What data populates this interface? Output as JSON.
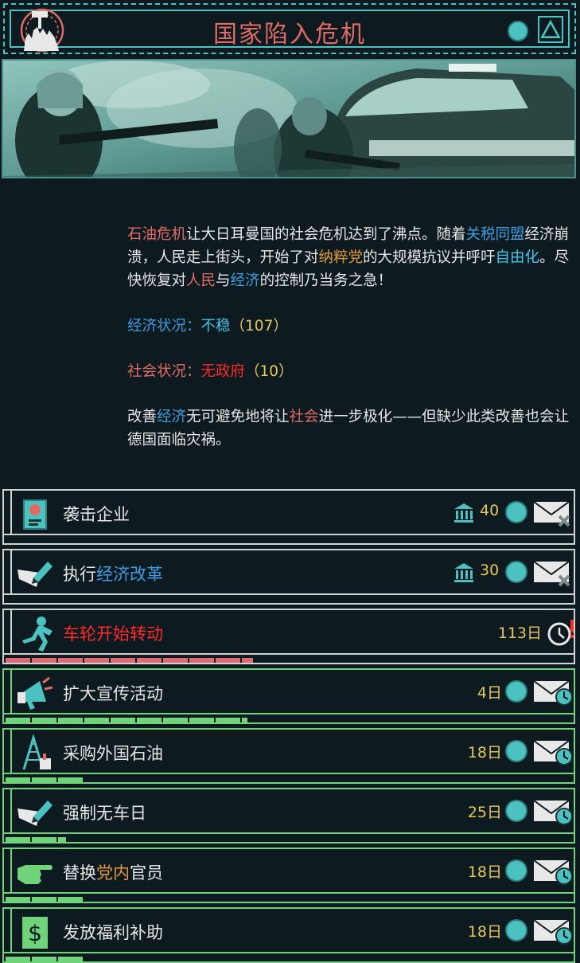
{
  "header": {
    "title": "国家陷入危机"
  },
  "description": {
    "p1": [
      {
        "t": "石油危机",
        "c": "red"
      },
      {
        "t": "让大日耳曼国的社会危机达到了沸点。随着",
        "c": ""
      },
      {
        "t": "关税同盟",
        "c": "blue"
      },
      {
        "t": "经济崩溃，人民走上街头，开始了对",
        "c": ""
      },
      {
        "t": "纳粹党",
        "c": "orange"
      },
      {
        "t": "的大规模抗议并呼吁",
        "c": ""
      },
      {
        "t": "自由化",
        "c": "cyan"
      },
      {
        "t": "。尽快恢复对",
        "c": ""
      },
      {
        "t": "人民",
        "c": "red"
      },
      {
        "t": "与",
        "c": ""
      },
      {
        "t": "经济",
        "c": "blue"
      },
      {
        "t": "的控制乃当务之急！",
        "c": ""
      }
    ],
    "economy_label": "经济状况：",
    "economy_value": "不稳",
    "economy_number": "（107）",
    "society_label": "社会状况：",
    "society_value": "无政府",
    "society_number": "（10）",
    "p3": [
      {
        "t": "改善",
        "c": ""
      },
      {
        "t": "经济",
        "c": "blue"
      },
      {
        "t": "无可避免地将让",
        "c": ""
      },
      {
        "t": "社会",
        "c": "red"
      },
      {
        "t": "进一步极化——但缺少此类改善也会让德国面临灾祸。",
        "c": ""
      }
    ]
  },
  "decisions": [
    {
      "label": "袭击企业",
      "cost": "40",
      "icon": "document-stamp-icon",
      "state": "locked",
      "progress": 0
    },
    {
      "label_parts": [
        {
          "t": "执行",
          "c": ""
        },
        {
          "t": "经济改革",
          "c": "blue"
        }
      ],
      "cost": "30",
      "icon": "pen-paper-icon",
      "state": "locked",
      "progress": 0
    },
    {
      "label": "车轮开始转动",
      "days": "113日",
      "icon": "running-man-icon",
      "state": "timed",
      "progress": 0.44
    },
    {
      "label": "扩大宣传活动",
      "days": "4日",
      "icon": "megaphone-icon",
      "state": "active",
      "progress": 0.43
    },
    {
      "label": "采购外国石油",
      "days": "18日",
      "icon": "oil-derrick-icon",
      "state": "active",
      "progress": 0.14
    },
    {
      "label": "强制无车日",
      "days": "25日",
      "icon": "pen-paper-icon",
      "state": "active",
      "progress": 0.11
    },
    {
      "label_parts": [
        {
          "t": "替换",
          "c": ""
        },
        {
          "t": "党内",
          "c": "orange"
        },
        {
          "t": "官员",
          "c": ""
        }
      ],
      "days": "18日",
      "icon": "pointing-hand-icon",
      "state": "active",
      "progress": 0.14
    },
    {
      "label": "发放福利补助",
      "days": "18日",
      "icon": "dollar-note-icon",
      "state": "active",
      "progress": 0.14
    }
  ],
  "colors": {
    "accent_cyan": "#4cc2c0",
    "title_red": "#e06a64",
    "active_green": "#6fd37a",
    "cost_yellow": "#e6c85a",
    "warning_red": "#ff2a2a"
  }
}
